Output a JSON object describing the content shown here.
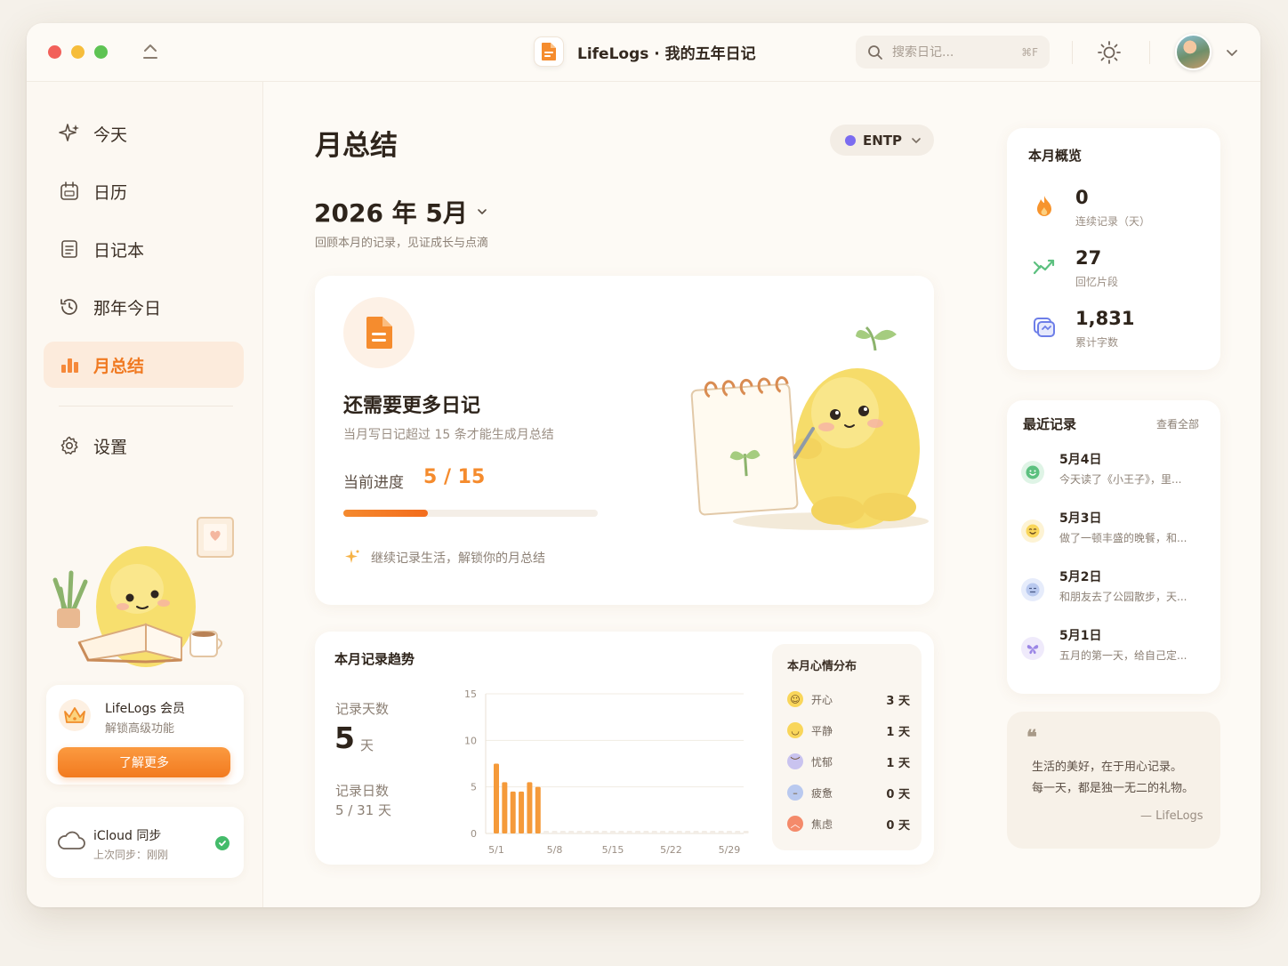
{
  "app": {
    "title": "LifeLogs · 我的五年日记"
  },
  "search": {
    "placeholder": "搜索日记...",
    "shortcut": "⌘F"
  },
  "sidebar": {
    "items": [
      {
        "label": "今天",
        "icon": "sparkle-icon"
      },
      {
        "label": "日历",
        "icon": "calendar-icon"
      },
      {
        "label": "日记本",
        "icon": "notebook-icon"
      },
      {
        "label": "那年今日",
        "icon": "history-icon"
      },
      {
        "label": "月总结",
        "icon": "bar-chart-icon",
        "active": true
      }
    ],
    "settings": {
      "label": "设置",
      "icon": "gear-icon"
    },
    "member": {
      "title": "LifeLogs 会员",
      "subtitle": "解锁高级功能",
      "button": "了解更多"
    },
    "icloud": {
      "title": "iCloud 同步",
      "subtitle": "上次同步：刚刚"
    }
  },
  "main": {
    "page_title": "月总结",
    "mbti": {
      "label": "ENTP",
      "color": "#7b6cf0"
    },
    "month": {
      "title": "2026 年 5月",
      "subtitle": "回顾本月的记录，见证成长与点滴"
    },
    "hero": {
      "title": "还需要更多日记",
      "subtitle": "当月写日记超过 15 条才能生成月总结",
      "progress_label": "当前进度",
      "progress_value": "5 / 15",
      "progress_fraction": 0.3333,
      "hint": "继续记录生活，解锁你的月总结"
    },
    "trend": {
      "title": "本月记录趋势",
      "days_label": "记录天数",
      "days_value": "5",
      "days_unit": "天",
      "logged_label": "记录日数",
      "logged_value": "5 / 31 天"
    },
    "mood": {
      "title": "本月心情分布",
      "items": [
        {
          "name": "开心",
          "count": "3 天",
          "icon": "happy-face-icon",
          "color": "#f9d65a"
        },
        {
          "name": "平静",
          "count": "1 天",
          "icon": "calm-face-icon",
          "color": "#f9d65a"
        },
        {
          "name": "忧郁",
          "count": "1 天",
          "icon": "sad-face-icon",
          "color": "#c9c3ef"
        },
        {
          "name": "疲惫",
          "count": "0 天",
          "icon": "tired-face-icon",
          "color": "#b9c9ef"
        },
        {
          "name": "焦虑",
          "count": "0 天",
          "icon": "angry-face-icon",
          "color": "#f48a6a"
        }
      ]
    }
  },
  "chart_data": {
    "type": "bar",
    "title": "本月记录趋势",
    "x": [
      "5/1",
      "5/2",
      "5/3",
      "5/4",
      "5/5",
      "5/6",
      "5/7",
      "5/8",
      "5/9",
      "5/10",
      "5/11",
      "5/12",
      "5/13",
      "5/14",
      "5/15",
      "5/16",
      "5/17",
      "5/18",
      "5/19",
      "5/20",
      "5/21",
      "5/22",
      "5/23",
      "5/24",
      "5/25",
      "5/26",
      "5/27",
      "5/28",
      "5/29",
      "5/30",
      "5/31"
    ],
    "values": [
      7.5,
      5.5,
      4.5,
      4.5,
      5.5,
      5,
      0,
      0,
      0,
      0,
      0,
      0,
      0,
      0,
      0,
      0,
      0,
      0,
      0,
      0,
      0,
      0,
      0,
      0,
      0,
      0,
      0,
      0,
      0,
      0,
      0
    ],
    "x_tick_labels": [
      "5/1",
      "5/8",
      "5/15",
      "5/22",
      "5/29"
    ],
    "y_ticks": [
      0,
      5,
      10,
      15
    ],
    "ylim": [
      0,
      15
    ],
    "color": "#f59a3a",
    "grid": true
  },
  "overview": {
    "title": "本月概览",
    "items": [
      {
        "value": "0",
        "label": "连续记录（天）",
        "icon": "flame-icon"
      },
      {
        "value": "27",
        "label": "回忆片段",
        "icon": "trend-icon"
      },
      {
        "value": "1,831",
        "label": "累计字数",
        "icon": "text-count-icon"
      }
    ]
  },
  "recent": {
    "title": "最近记录",
    "view_all": "查看全部",
    "items": [
      {
        "date": "5月4日",
        "text": "今天读了《小王子》，里...",
        "icon": "smile-face-icon",
        "color": "#6fce8c"
      },
      {
        "date": "5月3日",
        "text": "做了一顿丰盛的晚餐，和...",
        "icon": "happy-face-icon",
        "color": "#f9d65a"
      },
      {
        "date": "5月2日",
        "text": "和朋友去了公园散步，天...",
        "icon": "calm-face-icon",
        "color": "#c5d3f4"
      },
      {
        "date": "5月1日",
        "text": "五月的第一天，给自己定...",
        "icon": "butterfly-icon",
        "color": "#e4dcf8"
      }
    ]
  },
  "quote": {
    "mark": "❝",
    "line1": "生活的美好，在于用心记录。",
    "line2": "每一天，都是独一无二的礼物。",
    "author": "— LifeLogs"
  }
}
